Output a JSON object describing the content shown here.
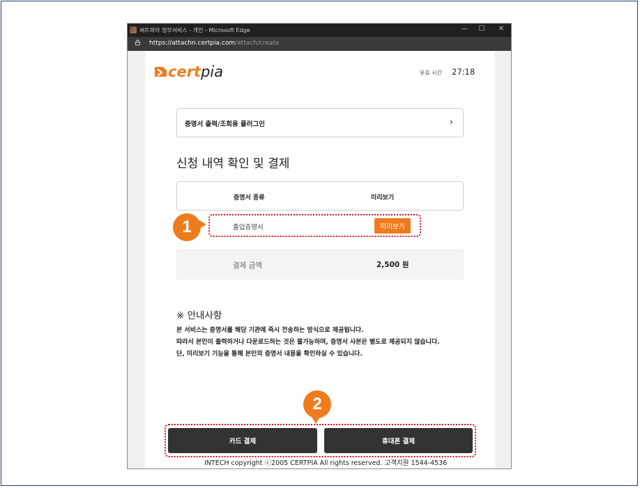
{
  "browser": {
    "title": "써트피아 정부서비스 - 개인 - Microsoft Edge",
    "url_host": "https://attachn.certpia.com",
    "url_path": "/attach/create",
    "controls": [
      "—",
      "☐",
      "✕"
    ]
  },
  "header": {
    "logo_cert": "cert",
    "logo_pia": "pia",
    "timer_label": "유효 시간",
    "timer_value": "27:18"
  },
  "plugin": {
    "label": "증명서 출력/조회용 플러그인",
    "chevron": "›"
  },
  "section_title": "신청 내역 확인 및 결제",
  "table": {
    "col_type": "증명서 종류",
    "col_preview": "미리보기",
    "rows": [
      {
        "name": "졸업증명서",
        "preview_button": "미리보기"
      }
    ]
  },
  "amount": {
    "label": "결제 금액",
    "value": "2,500 원"
  },
  "notice": {
    "title": "※ 안내사항",
    "lines": [
      "본 서비스는 증명서를 해당 기관에 즉시 전송하는 방식으로 제공됩니다.",
      "따라서 본인이 출력하거나 다운로드하는 것은 불가능하며, 증명서 사본은 별도로 제공되지 않습니다.",
      "단, 미리보기 기능을 통해 본인의 증명서 내용을 확인하실 수 있습니다."
    ]
  },
  "buttons": {
    "card": "카드 결제",
    "phone": "휴대폰 결제"
  },
  "annotations": {
    "badge_1": "1",
    "badge_2": "2",
    "highlight_color": "#d0111b",
    "badge_color": "#ee7c1f"
  },
  "footer": "INTECH copyright ⓒ2005 CERTPIA All rights reserved. 고객지원 1544-4536",
  "colors": {
    "brand_orange": "#ee7c1f",
    "button_dark": "#333333"
  }
}
